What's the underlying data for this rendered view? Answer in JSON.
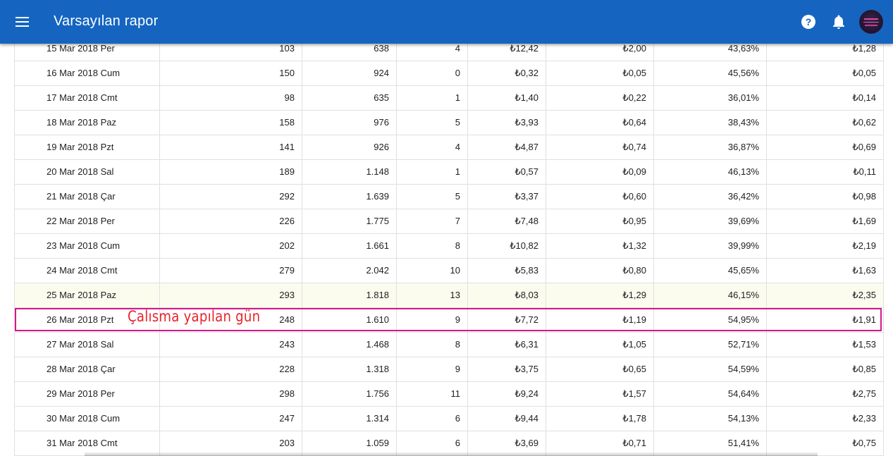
{
  "appbar": {
    "title": "Varsayılan rapor",
    "menu_icon": "menu-icon",
    "help_icon": "help-circle-icon",
    "bell_icon": "bell-icon",
    "color": "#1565c0"
  },
  "annotation": {
    "text": "Çalısma yapılan gün",
    "color": "#e8232a",
    "box_color": "#d6168c"
  },
  "table": {
    "rows": [
      [
        "15 Mar 2018 Per",
        "103",
        "638",
        "4",
        "₺12,42",
        "₺2,00",
        "43,63%",
        "₺1,28"
      ],
      [
        "16 Mar 2018 Cum",
        "150",
        "924",
        "0",
        "₺0,32",
        "₺0,05",
        "45,56%",
        "₺0,05"
      ],
      [
        "17 Mar 2018 Cmt",
        "98",
        "635",
        "1",
        "₺1,40",
        "₺0,22",
        "36,01%",
        "₺0,14"
      ],
      [
        "18 Mar 2018 Paz",
        "158",
        "976",
        "5",
        "₺3,93",
        "₺0,64",
        "38,43%",
        "₺0,62"
      ],
      [
        "19 Mar 2018 Pzt",
        "141",
        "926",
        "4",
        "₺4,87",
        "₺0,74",
        "36,87%",
        "₺0,69"
      ],
      [
        "20 Mar 2018 Sal",
        "189",
        "1.148",
        "1",
        "₺0,57",
        "₺0,09",
        "46,13%",
        "₺0,11"
      ],
      [
        "21 Mar 2018 Çar",
        "292",
        "1.639",
        "5",
        "₺3,37",
        "₺0,60",
        "36,42%",
        "₺0,98"
      ],
      [
        "22 Mar 2018 Per",
        "226",
        "1.775",
        "7",
        "₺7,48",
        "₺0,95",
        "39,69%",
        "₺1,69"
      ],
      [
        "23 Mar 2018 Cum",
        "202",
        "1.661",
        "8",
        "₺10,82",
        "₺1,32",
        "39,99%",
        "₺2,19"
      ],
      [
        "24 Mar 2018 Cmt",
        "279",
        "2.042",
        "10",
        "₺5,83",
        "₺0,80",
        "45,65%",
        "₺1,63"
      ],
      [
        "25 Mar 2018 Paz",
        "293",
        "1.818",
        "13",
        "₺8,03",
        "₺1,29",
        "46,15%",
        "₺2,35"
      ],
      [
        "26 Mar 2018 Pzt",
        "248",
        "1.610",
        "9",
        "₺7,72",
        "₺1,19",
        "54,95%",
        "₺1,91"
      ],
      [
        "27 Mar 2018 Sal",
        "243",
        "1.468",
        "8",
        "₺6,31",
        "₺1,05",
        "52,71%",
        "₺1,53"
      ],
      [
        "28 Mar 2018 Çar",
        "228",
        "1.318",
        "9",
        "₺3,75",
        "₺0,65",
        "54,59%",
        "₺0,85"
      ],
      [
        "29 Mar 2018 Per",
        "298",
        "1.756",
        "11",
        "₺9,24",
        "₺1,57",
        "54,64%",
        "₺2,75"
      ],
      [
        "30 Mar 2018 Cum",
        "247",
        "1.314",
        "6",
        "₺9,44",
        "₺1,78",
        "54,13%",
        "₺2,33"
      ],
      [
        "31 Mar 2018 Cmt",
        "203",
        "1.059",
        "6",
        "₺3,69",
        "₺0,71",
        "51,41%",
        "₺0,75"
      ]
    ],
    "highlight_row_index": 10
  }
}
